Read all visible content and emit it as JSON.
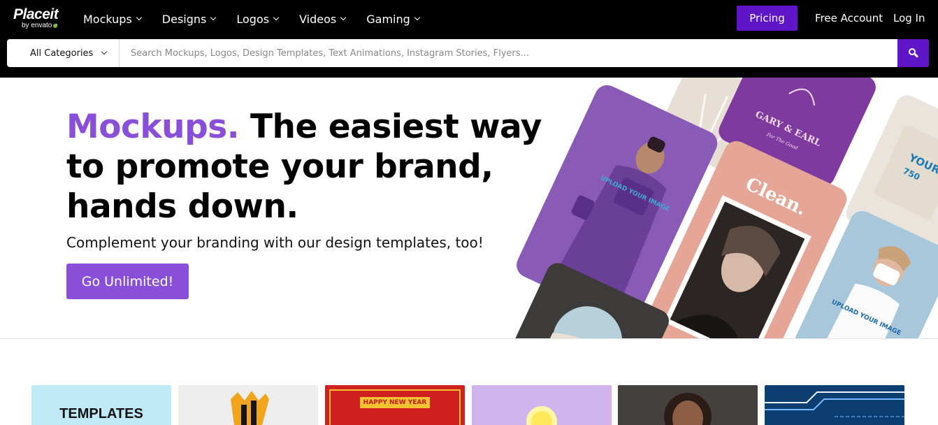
{
  "header": {
    "logo": {
      "main": "Placeit",
      "sub": "by envato"
    },
    "nav": [
      {
        "label": "Mockups"
      },
      {
        "label": "Designs"
      },
      {
        "label": "Logos"
      },
      {
        "label": "Videos"
      },
      {
        "label": "Gaming"
      }
    ],
    "pricing_label": "Pricing",
    "free_account_label": "Free Account",
    "login_label": "Log In"
  },
  "search": {
    "category": "All Categories",
    "placeholder": "Search Mockups, Logos, Design Templates, Text Animations, Instagram Stories, Flyers...",
    "button_icon": "search-icon"
  },
  "hero": {
    "headline_accent": "Mockups.",
    "headline_rest": " The easiest way to promote your brand, hands down.",
    "subline": "Complement your branding with our design templates, too!",
    "cta_label": "Go Unlimited!",
    "collage": {
      "tshirt_print": "UPLOAD YOUR IMAGE",
      "card_logo": "GARY & EARL",
      "card_logo_sub": "For The Good",
      "clean_card": "Clean.",
      "tank_print": "UPLOAD YOUR IMAGE",
      "tote_print": "YOUR IM",
      "tote_size": "750"
    }
  },
  "thumbnails": [
    {
      "label": "TEMPLATES"
    },
    {
      "label": ""
    },
    {
      "label": "HAPPY NEW YEAR"
    },
    {
      "label": ""
    },
    {
      "label": ""
    },
    {
      "label": ""
    }
  ],
  "colors": {
    "nav_bg": "#000000",
    "brand_purple": "#5f16c9",
    "accent_purple": "#8a4fd8"
  }
}
